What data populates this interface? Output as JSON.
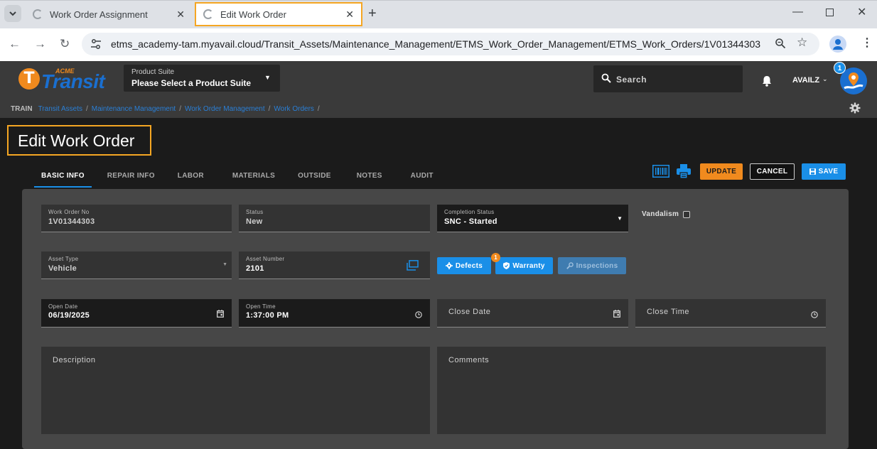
{
  "browser": {
    "tabs": [
      {
        "title": "Work Order Assignment"
      },
      {
        "title": "Edit Work Order"
      }
    ],
    "url": "etms_academy-tam.myavail.cloud/Transit_Assets/Maintenance_Management/ETMS_Work_Order_Management/ETMS_Work_Orders/1V01344303"
  },
  "header": {
    "logo_small": "ACME",
    "logo_text": "Transit",
    "product_suite_label": "Product Suite",
    "product_suite_value": "Please Select a Product Suite",
    "search_placeholder": "Search",
    "user": "AVAILZ",
    "notification_count": "1"
  },
  "breadcrumb": {
    "prefix": "TRAIN",
    "items": [
      "Transit Assets",
      "Maintenance Management",
      "Work Order Management",
      "Work Orders"
    ]
  },
  "page": {
    "title": "Edit Work Order",
    "tabs": [
      "BASIC INFO",
      "REPAIR INFO",
      "LABOR",
      "MATERIALS",
      "OUTSIDE",
      "NOTES",
      "AUDIT"
    ],
    "buttons": {
      "update": "UPDATE",
      "cancel": "CANCEL",
      "save": "SAVE"
    }
  },
  "form": {
    "work_order_no": {
      "label": "Work Order No",
      "value": "1V01344303"
    },
    "status": {
      "label": "Status",
      "value": "New"
    },
    "completion_status": {
      "label": "Completion Status",
      "value": "SNC - Started"
    },
    "vandalism": {
      "label": "Vandalism",
      "checked": false
    },
    "asset_type": {
      "label": "Asset Type",
      "value": "Vehicle"
    },
    "asset_number": {
      "label": "Asset Number",
      "value": "2101"
    },
    "defects_label": "Defects",
    "warranty_label": "Warranty",
    "warranty_badge": "1",
    "inspections_label": "Inspections",
    "open_date": {
      "label": "Open Date",
      "value": "06/19/2025"
    },
    "open_time": {
      "label": "Open Time",
      "value": "1:37:00 PM"
    },
    "close_date_placeholder": "Close Date",
    "close_time_placeholder": "Close Time",
    "description_placeholder": "Description",
    "comments_placeholder": "Comments"
  },
  "colors": {
    "accent_orange": "#f08a1e",
    "accent_blue": "#1a8fe8",
    "highlight": "#f5a623",
    "panel_bg": "#474747"
  }
}
